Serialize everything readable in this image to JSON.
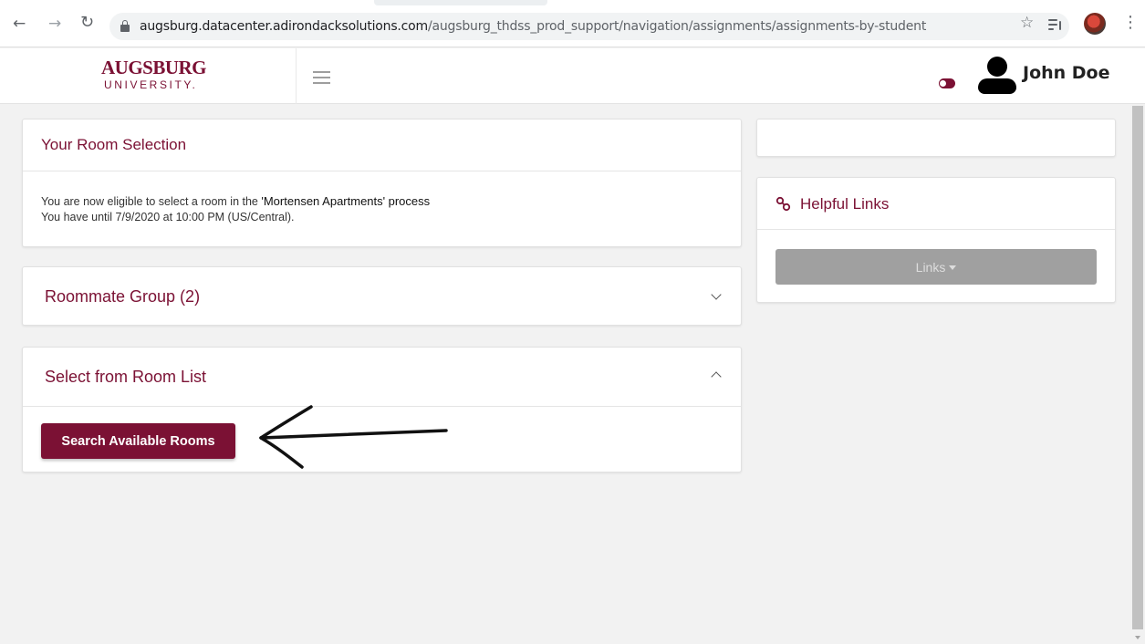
{
  "browser": {
    "url_host": "augsburg.datacenter.adirondacksolutions.com",
    "url_path": "/augsburg_thdss_prod_support/navigation/assignments/assignments-by-student",
    "back_icon": "arrow-left-icon",
    "forward_icon": "arrow-right-icon",
    "reload_icon": "reload-icon",
    "lock_icon": "lock-icon",
    "bookmark_icon": "star-icon",
    "media_icon": "media-queue-icon",
    "menu_icon": "kebab-icon"
  },
  "header": {
    "brand_name": "AUGSBURG",
    "brand_sub": "UNIVERSITY.",
    "menu_icon": "hamburger-icon",
    "user_name": "John Doe"
  },
  "room_selection": {
    "title": "Your Room Selection",
    "line1_prefix": "You are now eligible to select a room in the",
    "process_name": "'Mortensen Apartments'",
    "line1_suffix": "process",
    "line2": "You have until 7/9/2020 at 10:00 PM (US/Central)."
  },
  "roommate_group": {
    "title": "Roommate Group (2)",
    "expanded": false
  },
  "room_list": {
    "title": "Select from Room List",
    "expanded": true,
    "button_label": "Search Available Rooms"
  },
  "helpful_links": {
    "title": "Helpful Links",
    "icon": "link-icon",
    "button_label": "Links"
  },
  "colors": {
    "brand": "#7b1134",
    "disabled_button": "#a0a0a0"
  }
}
